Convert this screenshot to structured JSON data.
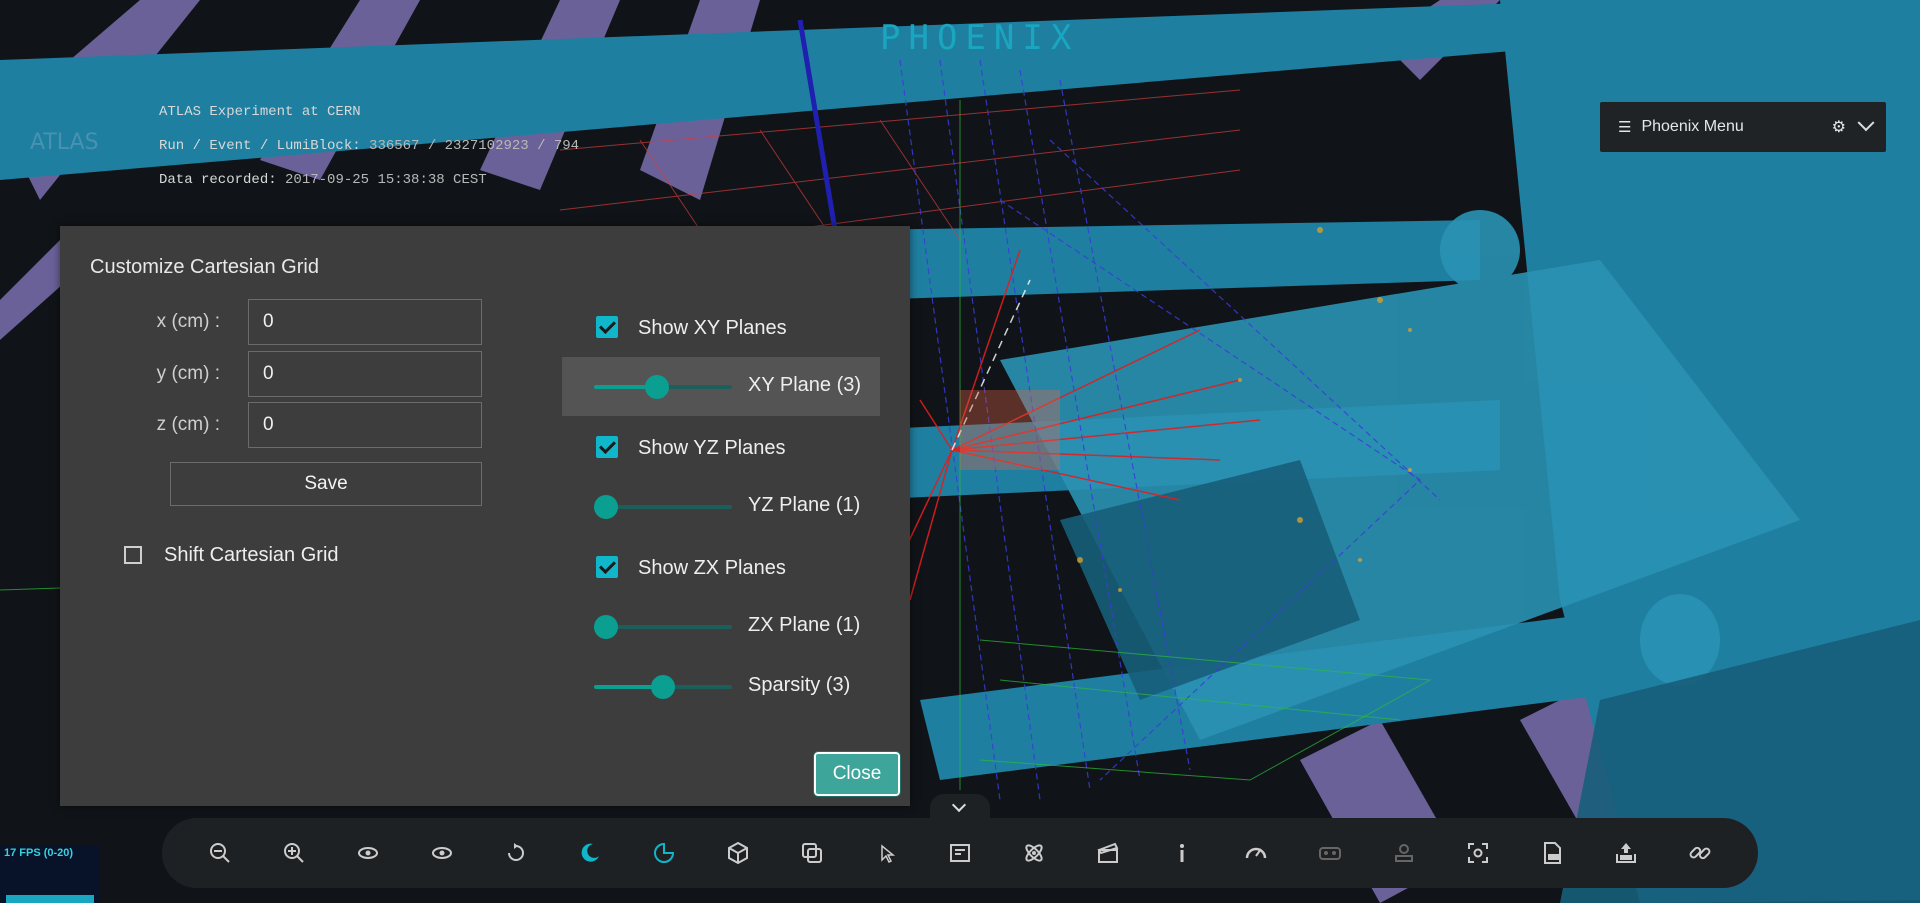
{
  "app": {
    "logo_text": "PHOENIX"
  },
  "event_info": {
    "experiment": "ATLAS Experiment at CERN",
    "run_label": "Run / Event / LumiBlock:",
    "run_value": "336567 / 2327102923 / 794",
    "date_label": "Data recorded:",
    "date_value": "2017-09-25 15:38:38 CEST"
  },
  "atlas_logo_text": "ATLAS",
  "phoenix_menu": {
    "label": "Phoenix Menu"
  },
  "dialog": {
    "title": "Customize Cartesian Grid",
    "x_label": "x (cm) :",
    "y_label": "y (cm) :",
    "z_label": "z (cm) :",
    "x_value": "0",
    "y_value": "0",
    "z_value": "0",
    "save_label": "Save",
    "shift_label": "Shift Cartesian Grid",
    "shift_checked": false,
    "show_xy_label": "Show XY Planes",
    "show_yz_label": "Show YZ Planes",
    "show_zx_label": "Show ZX Planes",
    "xy_plane_label": "XY Plane (3)",
    "yz_plane_label": "YZ Plane (1)",
    "zx_plane_label": "ZX Plane (1)",
    "sparsity_label": "Sparsity (3)",
    "xy_slider_fraction": 0.45,
    "yz_slider_fraction": 0.0,
    "zx_slider_fraction": 0.0,
    "sparsity_slider_fraction": 0.5,
    "close_label": "Close"
  },
  "fps": {
    "label": "17 FPS (0-20)"
  },
  "toolbar_icons": [
    "zoom-out-icon",
    "zoom-in-icon",
    "left-view-icon",
    "right-view-icon",
    "auto-rotate-icon",
    "dark-theme-icon",
    "clipping-icon",
    "geometry-icon",
    "overlay-view-icon",
    "object-selection-icon",
    "info-panel-icon",
    "event-selector-icon",
    "animate-icon",
    "info-icon",
    "performance-icon",
    "vr-icon",
    "ar-icon",
    "screenshot-icon",
    "export-png-icon",
    "import-icon",
    "share-link-icon"
  ],
  "colors": {
    "accent": "#10b6c9",
    "slider": "#0a9f90",
    "close_button": "#3da59a",
    "dialog_bg": "#3d3d3d"
  }
}
